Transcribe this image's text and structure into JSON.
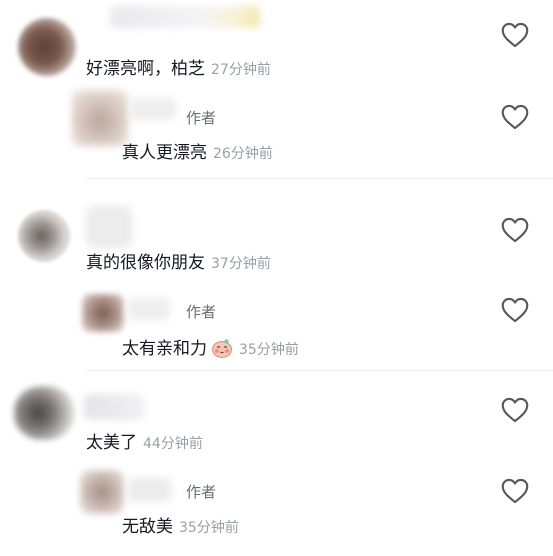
{
  "comments": [
    {
      "text": "好漂亮啊，柏芝",
      "time": "27分钟前",
      "reply": {
        "badge": "作者",
        "text": "真人更漂亮",
        "time": "26分钟前"
      }
    },
    {
      "text": "真的很像你朋友",
      "time": "37分钟前",
      "reply": {
        "badge": "作者",
        "text": "太有亲和力",
        "time": "35分钟前",
        "emoji": "blushing-face-emoji"
      }
    },
    {
      "text": "太美了",
      "time": "44分钟前",
      "reply": {
        "badge": "作者",
        "text": "无敌美",
        "time": "35分钟前"
      }
    }
  ],
  "icons": {
    "like": "heart-outline-icon"
  },
  "colors": {
    "text": "#161823",
    "time": "#9b9ea6",
    "badge": "#6b6e76",
    "icon": "#555760"
  }
}
